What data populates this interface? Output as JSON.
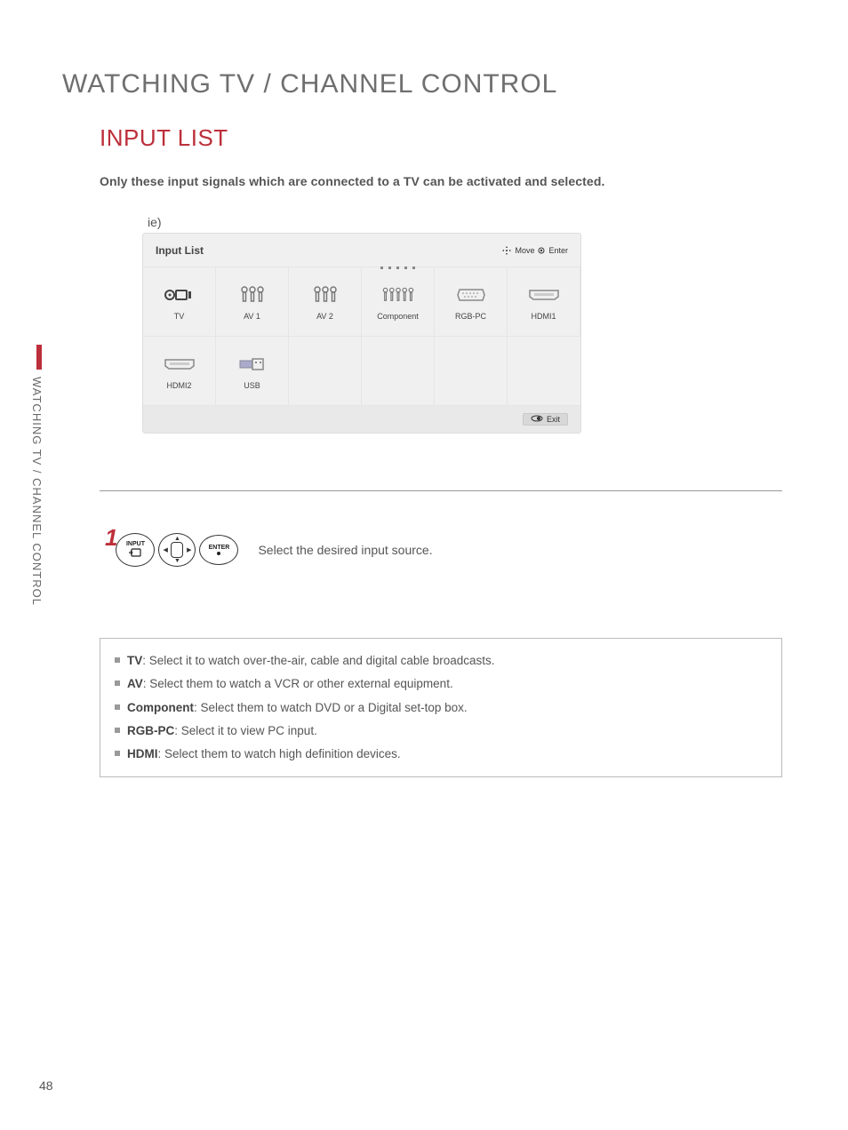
{
  "page": {
    "title": "WATCHING TV / CHANNEL CONTROL",
    "section": "INPUT LIST",
    "intro": "Only these input signals which are connected to a TV can be activated and selected.",
    "example_label": "ie)",
    "side_text": "WATCHING TV / CHANNEL CONTROL",
    "page_number": "48"
  },
  "panel": {
    "title": "Input List",
    "hint_move": "Move",
    "hint_enter": "Enter",
    "exit_label": "Exit",
    "inputs": [
      {
        "label": "TV"
      },
      {
        "label": "AV 1"
      },
      {
        "label": "AV 2"
      },
      {
        "label": "Component"
      },
      {
        "label": "RGB-PC"
      },
      {
        "label": "HDMI1"
      },
      {
        "label": "HDMI2"
      },
      {
        "label": "USB"
      }
    ]
  },
  "step": {
    "num": "1",
    "input_btn": "INPUT",
    "enter_btn": "ENTER",
    "text": "Select the desired input source."
  },
  "defs": [
    {
      "term": "TV",
      "desc": ": Select it to watch over-the-air, cable and digital cable broadcasts."
    },
    {
      "term": "AV",
      "desc": ": Select them to watch a VCR or other external equipment."
    },
    {
      "term": "Component",
      "desc": ": Select them to watch DVD or a Digital set-top box."
    },
    {
      "term": "RGB-PC",
      "desc": ": Select it to view PC input."
    },
    {
      "term": "HDMI",
      "desc": ": Select them to watch high definition devices."
    }
  ]
}
